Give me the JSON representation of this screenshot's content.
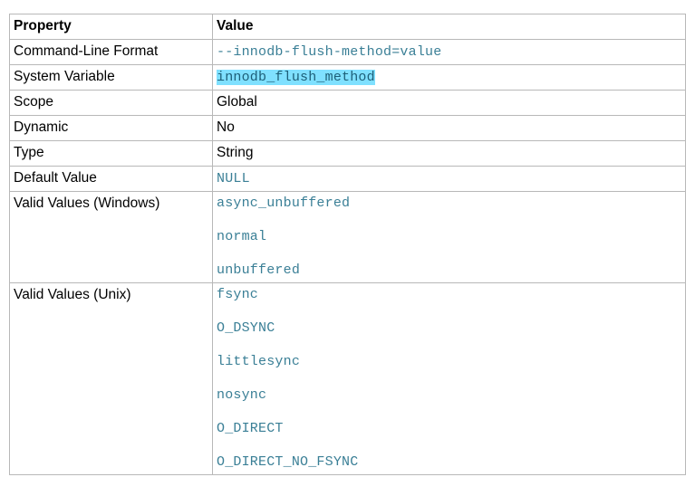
{
  "header": {
    "property": "Property",
    "value": "Value"
  },
  "rows": [
    {
      "property": "Command-Line Format",
      "value": "--innodb-flush-method=value"
    },
    {
      "property": "System Variable",
      "value": "innodb_flush_method"
    },
    {
      "property": "Scope",
      "value": "Global"
    },
    {
      "property": "Dynamic",
      "value": "No"
    },
    {
      "property": "Type",
      "value": "String"
    },
    {
      "property": "Default Value",
      "value": "NULL"
    },
    {
      "property": "Valid Values (Windows)",
      "values": [
        "async_unbuffered",
        "normal",
        "unbuffered"
      ]
    },
    {
      "property": "Valid Values (Unix)",
      "values": [
        "fsync",
        "O_DSYNC",
        "littlesync",
        "nosync",
        "O_DIRECT",
        "O_DIRECT_NO_FSYNC"
      ]
    }
  ],
  "colors": {
    "code_text": "#3a7f96",
    "highlight": "#7fe0ff",
    "border": "#b8b8b8"
  }
}
